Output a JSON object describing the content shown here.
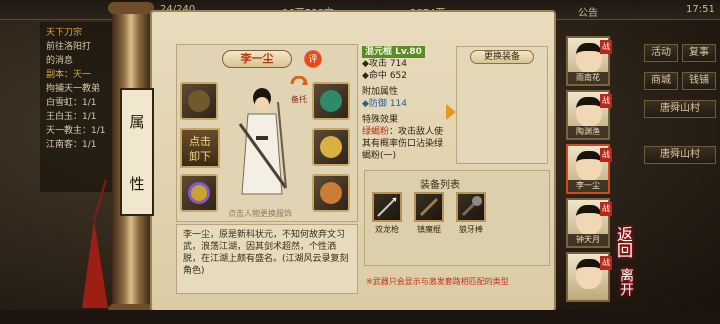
{
  "topbar": {
    "capacity": "24/240",
    "money": "96两538文",
    "ingots": "2874两",
    "announce": "公告",
    "clock": "17:51"
  },
  "left_log": {
    "lines": [
      "天下刀宗",
      "前往洛阳打",
      "的消息",
      "副本：天一",
      "拘捕天一教弟",
      "白雪虹：1/1",
      "王白玉：1/1",
      "天一教主：1/1",
      "江南客：1/1"
    ]
  },
  "side_tab": {
    "ch1": "属",
    "ch2": "性"
  },
  "character": {
    "name": "李一尘",
    "eval_label": "评",
    "backup_label": "备托",
    "unequip_label": "点击\n卸下",
    "hint": "点击人物更换服饰",
    "description": "李一尘，原是新科状元，不知何故弃文习武，浪荡江湖，因其剑术超然，个性洒脱，在江湖上颇有盛名。(江湖风云录复刻角色)"
  },
  "stats": {
    "item_title": "混元棍 Lv.80",
    "attack_label": "攻击",
    "attack_value": "714",
    "hit_label": "命中",
    "hit_value": "652",
    "extra_title": "附加属性",
    "defense_label": "防御",
    "defense_value": "114",
    "special_title": "特殊效果",
    "special_name": "绿蝎粉",
    "special_desc": "：攻击敌人使其有概率伤口沾染绿蝎粉(一)"
  },
  "change_equip": {
    "title": "更换装备"
  },
  "equip_list": {
    "title": "装备列表",
    "items": [
      {
        "name": "双龙枪"
      },
      {
        "name": "镇魔棍"
      },
      {
        "name": "狼牙棒"
      }
    ],
    "note": "※武器只会显示与激发套路相匹配的类型"
  },
  "right_menu": {
    "buttons": [
      "活动",
      "复事",
      "商城",
      "钱铺"
    ],
    "location": "唐舜山村",
    "location2": "唐舜山村"
  },
  "party": [
    {
      "name": "雨南花",
      "flag": "战",
      "active": false
    },
    {
      "name": "陶渊渔",
      "flag": "战",
      "active": false
    },
    {
      "name": "李一尘",
      "flag": "战",
      "active": true
    },
    {
      "name": "钟天月",
      "flag": "战",
      "active": false
    },
    {
      "name": "",
      "flag": "战",
      "active": false
    }
  ],
  "back_button": {
    "label": "返回"
  },
  "leave_button": {
    "label": "离开"
  }
}
